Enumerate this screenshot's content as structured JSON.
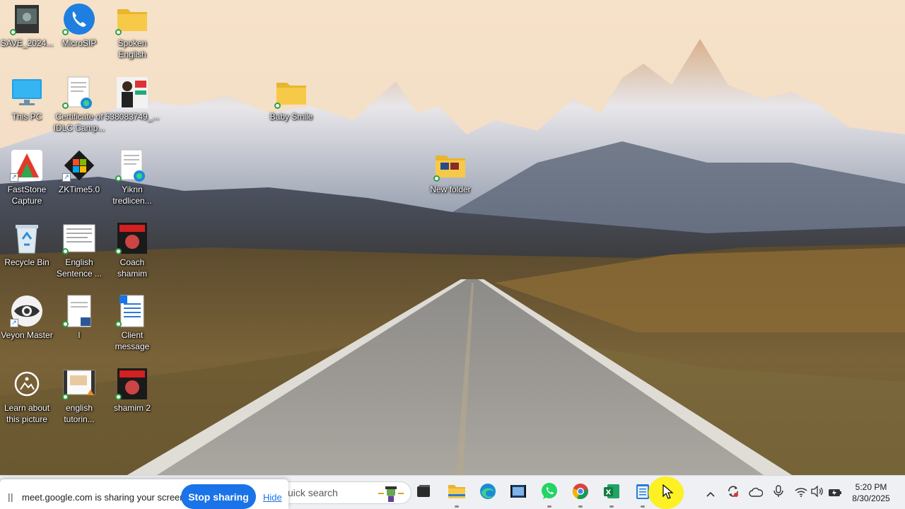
{
  "desktop": {
    "icons": [
      {
        "label": "SAVE_2024...",
        "icon": "video-file-icon"
      },
      {
        "label": "MicroSIP",
        "icon": "phone-app-icon"
      },
      {
        "label": "Spoken English",
        "icon": "folder-icon"
      },
      {
        "label": "This PC",
        "icon": "monitor-icon"
      },
      {
        "label": "Certificate of IDLC Camp...",
        "icon": "pdf-edge-icon"
      },
      {
        "label": "538083749_...",
        "icon": "image-file-icon"
      },
      {
        "label": "Baby Smile",
        "icon": "folder-icon"
      },
      {
        "label": "FastStone Capture",
        "icon": "faststone-icon"
      },
      {
        "label": "ZKTime5.0",
        "icon": "zktime-icon"
      },
      {
        "label": "Yiknn tredlicen...",
        "icon": "pdf-edge-icon"
      },
      {
        "label": "New folder",
        "icon": "folder-icon"
      },
      {
        "label": "Recycle Bin",
        "icon": "recycle-bin-icon"
      },
      {
        "label": "English Sentence ...",
        "icon": "document-icon"
      },
      {
        "label": "Coach shamim",
        "icon": "poster-icon"
      },
      {
        "label": "Veyon Master",
        "icon": "veyon-eye-icon"
      },
      {
        "label": "l",
        "icon": "word-document-icon"
      },
      {
        "label": "Client message",
        "icon": "text-document-icon"
      },
      {
        "label": "Learn about this picture",
        "icon": "camera-info-icon"
      },
      {
        "label": "english tutorin...",
        "icon": "video-thumbnail-icon"
      },
      {
        "label": "shamim 2",
        "icon": "poster-icon"
      }
    ]
  },
  "taskbar": {
    "search_placeholder": "uick search",
    "apps": [
      {
        "name": "task-view",
        "icon": "task-view-icon"
      },
      {
        "name": "file-explorer",
        "icon": "folder-icon"
      },
      {
        "name": "edge",
        "icon": "edge-icon"
      },
      {
        "name": "media",
        "icon": "film-icon"
      },
      {
        "name": "whatsapp",
        "icon": "whatsapp-icon"
      },
      {
        "name": "chrome",
        "icon": "chrome-icon"
      },
      {
        "name": "excel",
        "icon": "excel-icon"
      },
      {
        "name": "notepad",
        "icon": "notepad-icon"
      }
    ],
    "clock": {
      "time": "5:20 PM",
      "date": "8/30/2025"
    }
  },
  "share_bar": {
    "message": "meet.google.com is sharing your screen.",
    "stop_label": "Stop sharing",
    "hide_label": "Hide"
  },
  "colors": {
    "accent_blue": "#1a73e8",
    "folder_yellow": "#f7c948",
    "cursor_highlight": "#fff000"
  }
}
